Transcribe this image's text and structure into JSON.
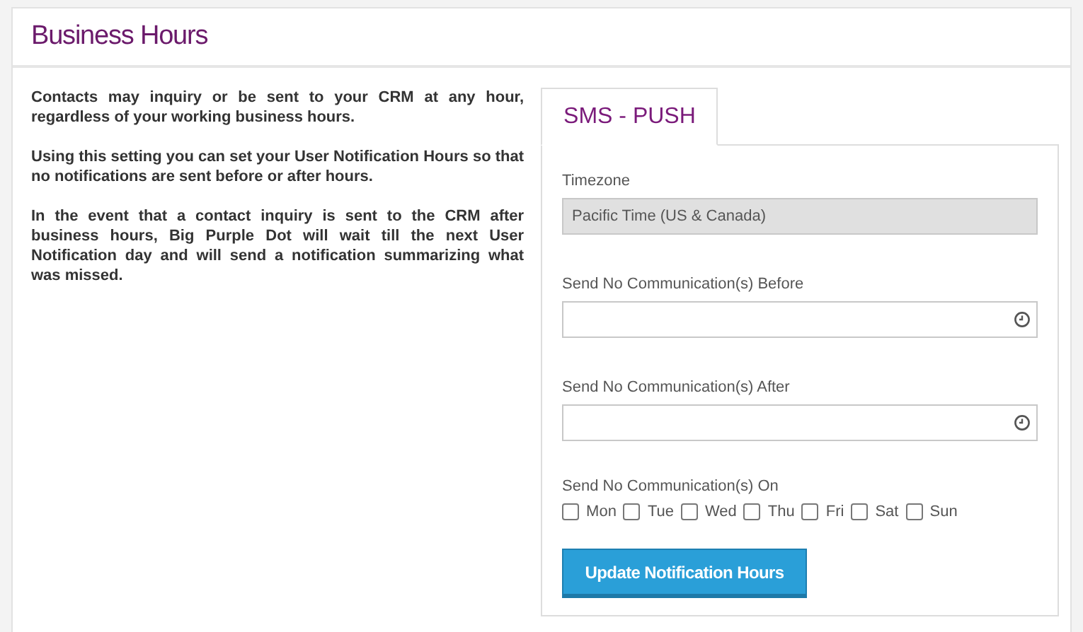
{
  "header": {
    "title": "Business Hours"
  },
  "description": [
    "Contacts may inquiry or be sent to your CRM at any hour, regardless of your working business hours.",
    "Using this setting you can set your User Notification Hours so that no notifications are sent before or after hours.",
    "In the event that a contact inquiry is sent to the CRM after business hours, Big Purple Dot will wait till the next User Notification day and will send a notification summarizing what was missed."
  ],
  "tabs": [
    {
      "label": "SMS - PUSH",
      "selected": true
    }
  ],
  "form": {
    "timezone": {
      "label": "Timezone",
      "value": "Pacific Time (US & Canada)",
      "disabled": true
    },
    "before": {
      "label": "Send No Communication(s) Before"
    },
    "after": {
      "label": "Send No Communication(s) After"
    },
    "days_label": "Send No Communication(s) On",
    "days": [
      {
        "label": "Mon",
        "checked": false
      },
      {
        "label": "Tue",
        "checked": false
      },
      {
        "label": "Wed",
        "checked": false
      },
      {
        "label": "Thu",
        "checked": false
      },
      {
        "label": "Fri",
        "checked": false
      },
      {
        "label": "Sat",
        "checked": false
      },
      {
        "label": "Sun",
        "checked": false
      }
    ],
    "submit": "Update Notification Hours"
  }
}
